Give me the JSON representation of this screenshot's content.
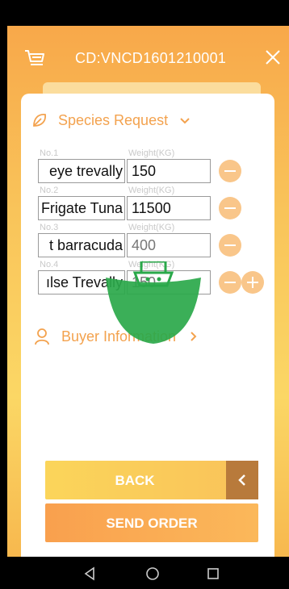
{
  "header": {
    "title": "CD:VNCD1601210001",
    "cart_icon": "cart-icon",
    "close_icon": "close-icon"
  },
  "species_section": {
    "title": "Species Request",
    "icon": "leaf-icon",
    "toggle_icon": "chevron-down-icon"
  },
  "rows": [
    {
      "label": "No.1",
      "weight_label": "Weight(KG)",
      "species": "eye trevally",
      "weight": "150",
      "weight_placeholder": false
    },
    {
      "label": "No.2",
      "weight_label": "Weight(KG)",
      "species": "Frigate Tuna",
      "weight": "11500",
      "weight_placeholder": false
    },
    {
      "label": "No.3",
      "weight_label": "Weight(KG)",
      "species": "t barracuda",
      "weight": "400",
      "weight_placeholder": true
    },
    {
      "label": "No.4",
      "weight_label": "Weight(KG)",
      "species": "ılse Trevally",
      "weight": "150",
      "weight_placeholder": true
    }
  ],
  "buyer_section": {
    "title": "Buyer Information",
    "icon": "person-icon",
    "toggle_icon": "chevron-right-icon"
  },
  "buttons": {
    "back": "BACK",
    "send": "SEND ORDER"
  },
  "colors": {
    "accent": "#f3a24e",
    "header_gradient_top": "#f8a84a",
    "header_gradient_bottom": "#fbd765",
    "watermark_green": "#2aa84a",
    "back_arrow_box": "#b87a3b"
  },
  "nav": {
    "back_icon": "triangle-back-icon",
    "home_icon": "circle-home-icon",
    "recents_icon": "square-recents-icon"
  }
}
